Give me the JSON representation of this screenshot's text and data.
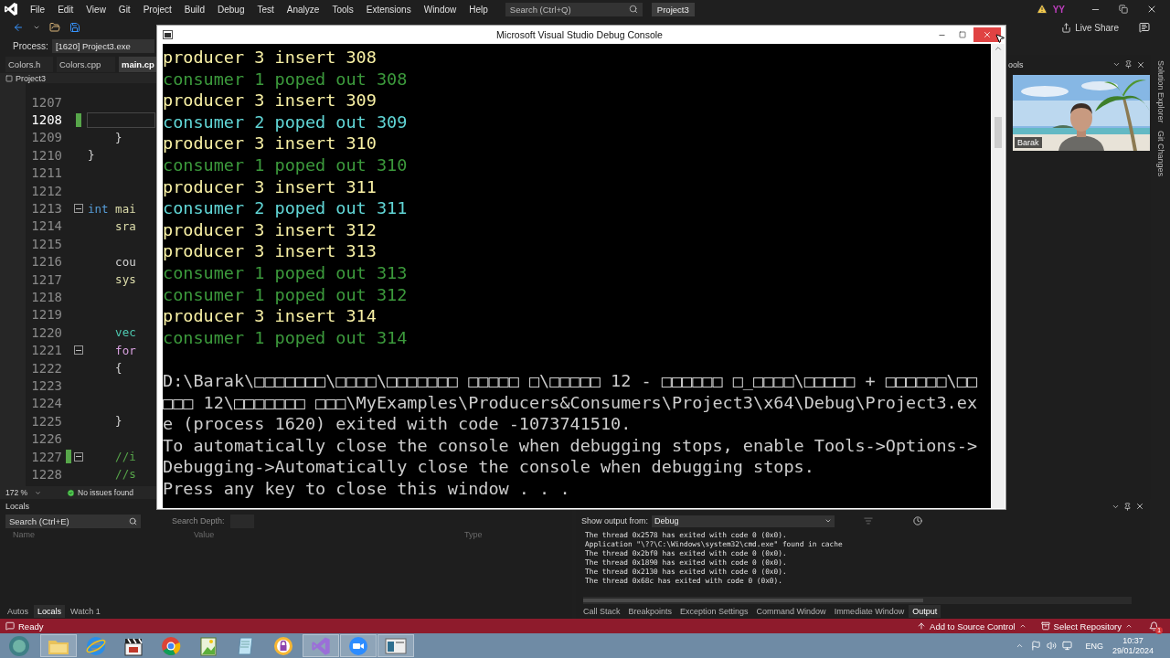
{
  "menu_bar": {
    "items": [
      "File",
      "Edit",
      "View",
      "Git",
      "Project",
      "Build",
      "Debug",
      "Test",
      "Analyze",
      "Tools",
      "Extensions",
      "Window",
      "Help"
    ],
    "search": {
      "placeholder": "Search (Ctrl+Q)"
    },
    "solution_button": "Project3",
    "account": "YY"
  },
  "toolbar": {
    "live_share": "Live Share"
  },
  "process_bar": {
    "label": "Process:",
    "value": "[1620] Project3.exe"
  },
  "document_tabs": [
    {
      "label": "Colors.h",
      "selected": false
    },
    {
      "label": "Colors.cpp",
      "selected": false
    },
    {
      "label": "main.cp",
      "selected": true
    }
  ],
  "navigation_bar": {
    "project": "Project3"
  },
  "editor": {
    "lines": [
      {
        "number": "1207",
        "current": false,
        "changed": false,
        "fold": false
      },
      {
        "number": "1208",
        "current": true,
        "changed": true,
        "fold": false
      },
      {
        "number": "1209",
        "current": false,
        "changed": false,
        "fold": false,
        "tokens": [
          {
            "text": "    }",
            "kind": "plain"
          }
        ]
      },
      {
        "number": "1210",
        "current": false,
        "changed": false,
        "fold": false,
        "tokens": [
          {
            "text": "}",
            "kind": "plain"
          }
        ]
      },
      {
        "number": "1211",
        "current": false,
        "changed": false,
        "fold": false
      },
      {
        "number": "1212",
        "current": false,
        "changed": false,
        "fold": false
      },
      {
        "number": "1213",
        "current": false,
        "changed": false,
        "fold": true,
        "tokens": [
          {
            "text": "int",
            "kind": "keyword"
          },
          {
            "text": " mai",
            "kind": "function"
          }
        ]
      },
      {
        "number": "1214",
        "current": false,
        "changed": false,
        "fold": false,
        "tokens": [
          {
            "text": "    sra",
            "kind": "function"
          }
        ]
      },
      {
        "number": "1215",
        "current": false,
        "changed": false,
        "fold": false
      },
      {
        "number": "1216",
        "current": false,
        "changed": false,
        "fold": false,
        "tokens": [
          {
            "text": "    cou",
            "kind": "plain"
          }
        ]
      },
      {
        "number": "1217",
        "current": false,
        "changed": false,
        "fold": false,
        "tokens": [
          {
            "text": "    sys",
            "kind": "function"
          }
        ]
      },
      {
        "number": "1218",
        "current": false,
        "changed": false,
        "fold": false
      },
      {
        "number": "1219",
        "current": false,
        "changed": false,
        "fold": false
      },
      {
        "number": "1220",
        "current": false,
        "changed": false,
        "fold": false,
        "tokens": [
          {
            "text": "    vec",
            "kind": "type"
          }
        ]
      },
      {
        "number": "1221",
        "current": false,
        "changed": false,
        "fold": true,
        "tokens": [
          {
            "text": "    for",
            "kind": "control"
          }
        ]
      },
      {
        "number": "1222",
        "current": false,
        "changed": false,
        "fold": false,
        "tokens": [
          {
            "text": "    {",
            "kind": "plain"
          }
        ]
      },
      {
        "number": "1223",
        "current": false,
        "changed": false,
        "fold": false
      },
      {
        "number": "1224",
        "current": false,
        "changed": false,
        "fold": false
      },
      {
        "number": "1225",
        "current": false,
        "changed": false,
        "fold": false,
        "tokens": [
          {
            "text": "    }",
            "kind": "plain"
          }
        ]
      },
      {
        "number": "1226",
        "current": false,
        "changed": false,
        "fold": false
      },
      {
        "number": "1227",
        "current": false,
        "changed": true,
        "fold": true,
        "tokens": [
          {
            "text": "    //i",
            "kind": "comment"
          }
        ]
      },
      {
        "number": "1228",
        "current": false,
        "changed": false,
        "fold": false,
        "tokens": [
          {
            "text": "    //s",
            "kind": "comment"
          }
        ]
      }
    ],
    "zoom": "172 %",
    "issues": "No issues found"
  },
  "tool_pane": {
    "title": "ools",
    "video": {
      "kind": "picture",
      "caption": "Barak"
    }
  },
  "side_tabs": [
    "Solution Explorer",
    "Git Changes"
  ],
  "locals_panel": {
    "title": "Locals",
    "search": {
      "placeholder": "Search (Ctrl+E)"
    },
    "depth_label": "Search Depth:",
    "columns": [
      "Name",
      "Value",
      "Type"
    ],
    "tabs": [
      {
        "label": "Autos",
        "selected": false
      },
      {
        "label": "Locals",
        "selected": true
      },
      {
        "label": "Watch 1",
        "selected": false
      }
    ]
  },
  "output_panel": {
    "source_label": "Show output from:",
    "source": "Debug",
    "lines": [
      "The thread 0x2578 has exited with code 0 (0x0).",
      "Application \"\\??\\C:\\Windows\\system32\\cmd.exe\" found in cache",
      "The thread 0x2bf0 has exited with code 0 (0x0).",
      "The thread 0x1890 has exited with code 0 (0x0).",
      "The thread 0x2130 has exited with code 0 (0x0).",
      "The thread 0x68c has exited with code 0 (0x0)."
    ],
    "tabs": [
      {
        "label": "Call Stack",
        "selected": false
      },
      {
        "label": "Breakpoints",
        "selected": false
      },
      {
        "label": "Exception Settings",
        "selected": false
      },
      {
        "label": "Command Window",
        "selected": false
      },
      {
        "label": "Immediate Window",
        "selected": false
      },
      {
        "label": "Output",
        "selected": true
      }
    ]
  },
  "status_bar": {
    "text": "Ready",
    "source_control": "Add to Source Control",
    "repository": "Select Repository",
    "notifications": "1"
  },
  "taskbar": {
    "apps": [
      {
        "kind": "folder",
        "running": true
      },
      {
        "kind": "ie",
        "running": false
      },
      {
        "kind": "player",
        "running": false
      },
      {
        "kind": "chrome",
        "running": false
      },
      {
        "kind": "paint",
        "running": false
      },
      {
        "kind": "notepad",
        "running": false
      },
      {
        "kind": "vpn",
        "running": false
      },
      {
        "kind": "vs",
        "running": true
      },
      {
        "kind": "zoom",
        "running": true
      },
      {
        "kind": "console",
        "running": true
      }
    ],
    "language": "ENG",
    "time": "10:37",
    "date": "29/01/2024"
  },
  "console": {
    "title": "Microsoft Visual Studio Debug Console",
    "lines": [
      {
        "text": "producer 3 insert 308",
        "color": "#f9f1a5"
      },
      {
        "text": "consumer 1 poped out 308",
        "color": "#3c9a3c"
      },
      {
        "text": "producer 3 insert 309",
        "color": "#f9f1a5"
      },
      {
        "text": "consumer 2 poped out 309",
        "color": "#61d6d6"
      },
      {
        "text": "producer 3 insert 310",
        "color": "#f9f1a5"
      },
      {
        "text": "consumer 1 poped out 310",
        "color": "#3c9a3c"
      },
      {
        "text": "producer 3 insert 311",
        "color": "#f9f1a5"
      },
      {
        "text": "consumer 2 poped out 311",
        "color": "#61d6d6"
      },
      {
        "text": "producer 3 insert 312",
        "color": "#f9f1a5"
      },
      {
        "text": "producer 3 insert 313",
        "color": "#f9f1a5"
      },
      {
        "text": "consumer 1 poped out 313",
        "color": "#3c9a3c"
      },
      {
        "text": "consumer 1 poped out 312",
        "color": "#3c9a3c"
      },
      {
        "text": "producer 3 insert 314",
        "color": "#f9f1a5"
      },
      {
        "text": "consumer 1 poped out 314",
        "color": "#3c9a3c"
      }
    ],
    "exit_lines": [
      {
        "text": "D:\\Barak\\□□□□□□□\\□□□□\\□□□□□□□ □□□□□ □\\□□□□□ 12 - □□□□□□ □_□□□□\\□□□□□ + □□□□□□\\□□",
        "color": "#cccccc"
      },
      {
        "text": "□□□ 12\\□□□□□□□ □□□\\MyExamples\\Producers&Consumers\\Project3\\x64\\Debug\\Project3.ex",
        "color": "#cccccc"
      },
      {
        "text": "e (process 1620) exited with code -1073741510.",
        "color": "#cccccc"
      },
      {
        "text": "To automatically close the console when debugging stops, enable Tools->Options->",
        "color": "#cccccc"
      },
      {
        "text": "Debugging->Automatically close the console when debugging stops.",
        "color": "#cccccc"
      },
      {
        "text": "Press any key to close this window . . .",
        "color": "#cccccc"
      }
    ]
  }
}
